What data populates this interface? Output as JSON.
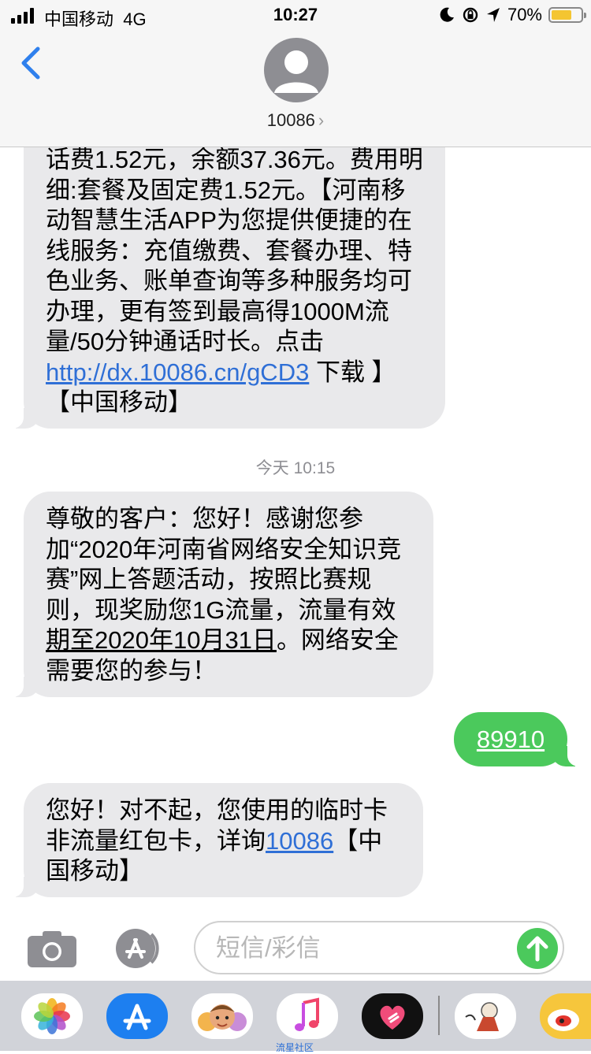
{
  "status_bar": {
    "carrier": "中国移动",
    "network": "4G",
    "time": "10:27",
    "battery": "70%",
    "battery_level": 0.7
  },
  "header": {
    "contact": "10086",
    "chevron": "›"
  },
  "messages": [
    {
      "side": "incoming",
      "text_before": "话费1.52元，余额37.36元。费用明细:套餐及固定费1.52元。【河南移动智慧生活APP为您提供便捷的在线服务：充值缴费、套餐办理、特色业务、账单查询等多种服务均可办理，更有签到最高得1000M流量/50分钟通话时长。点击 ",
      "link": "http://dx.10086.cn/gCD3",
      "text_after": " 下载 】【中国移动】"
    },
    {
      "side": "incoming",
      "timestamp": "今天 10:15",
      "text_before": "尊敬的客户：您好！感谢您参加“2020年河南省网络安全知识竞赛”网上答题活动，按照比赛规则，现奖励您1G流量，流量有效",
      "underlined": "期至2020年10月31日",
      "text_after": "。网络安全需要您的参与！"
    },
    {
      "side": "outgoing",
      "link": "89910"
    },
    {
      "side": "incoming",
      "text_before": "您好！对不起，您使用的临时卡非流量红包卡，详询",
      "link": "10086",
      "text_after": "【中国移动】"
    }
  ],
  "input": {
    "placeholder": "短信/彩信"
  },
  "app_drawer": {
    "apps": [
      "photos-app",
      "app-store-app",
      "memoji-app",
      "music-app",
      "digital-touch-app",
      "sticker-app",
      "weibo-app"
    ],
    "music_label": "流星社区"
  },
  "colors": {
    "incoming_bubble": "#e9e9eb",
    "outgoing_bubble": "#4bc95c",
    "link": "#2f6fd6",
    "header_bg": "#f6f6f6",
    "drawer_bg": "#d1d3d9"
  }
}
